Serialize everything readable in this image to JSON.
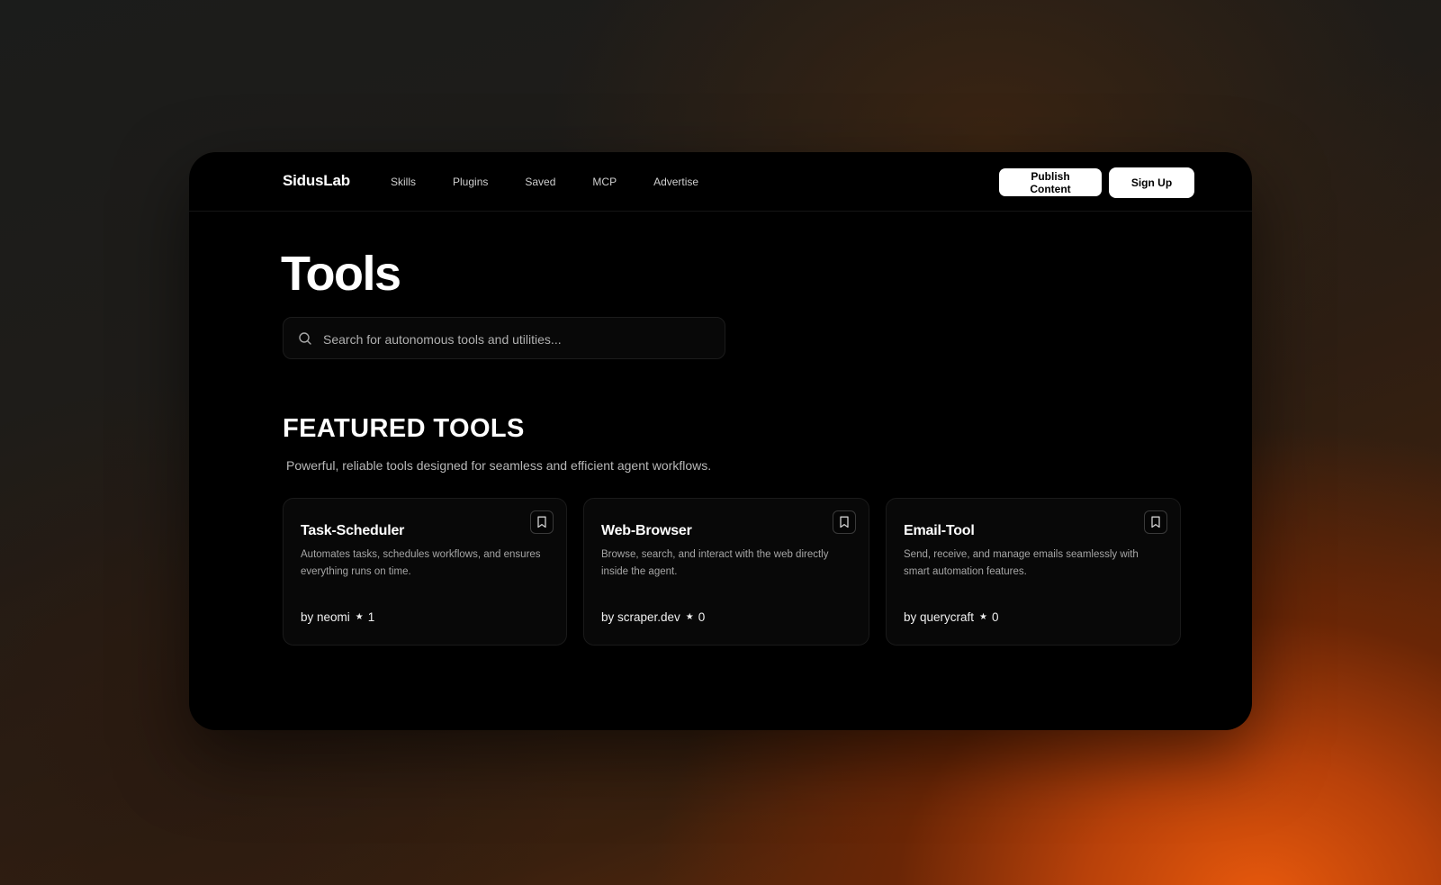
{
  "navbar": {
    "logo": "SidusLab",
    "links": [
      "Skills",
      "Plugins",
      "Saved",
      "MCP",
      "Advertise"
    ],
    "publish_label": "Publish Content",
    "signup_label": "Sign Up"
  },
  "page": {
    "title": "Tools"
  },
  "search": {
    "placeholder": "Search for autonomous tools and utilities...",
    "icon": "search-icon"
  },
  "featured": {
    "title": "FEATURED TOOLS",
    "subtitle": "Powerful, reliable tools designed for seamless and efficient agent workflows.",
    "cards": [
      {
        "title": "Task-Scheduler",
        "description": "Automates tasks, schedules workflows, and ensures everything runs on time.",
        "author": "by neomi",
        "stars": "1"
      },
      {
        "title": "Web-Browser",
        "description": "Browse, search, and interact with the web directly inside the agent.",
        "author": "by scraper.dev",
        "stars": "0"
      },
      {
        "title": "Email-Tool",
        "description": "Send, receive, and manage emails seamlessly with smart automation features.",
        "author": "by querycraft",
        "stars": "0"
      }
    ]
  },
  "colors": {
    "window_bg": "#000000",
    "accent_orange": "#e8590c",
    "button_bg": "#ffffff"
  }
}
